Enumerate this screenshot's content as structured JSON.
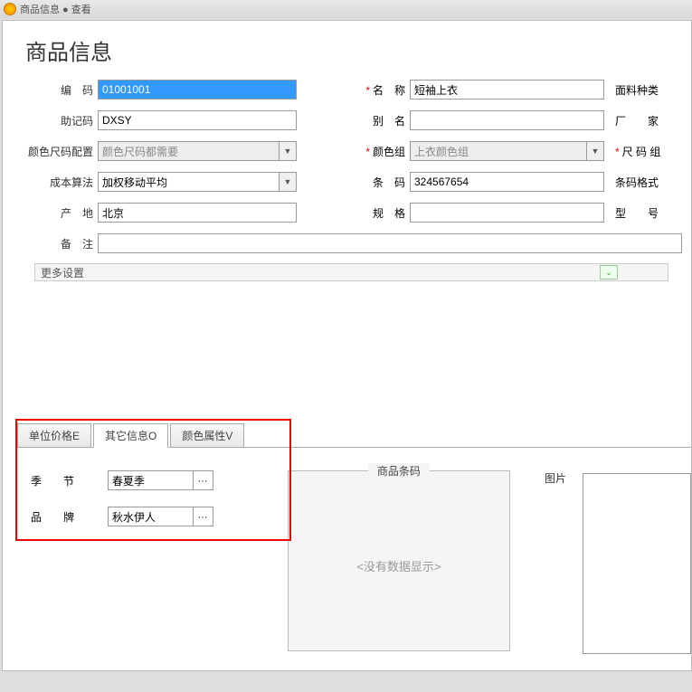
{
  "titlebar": {
    "text": "商品信息 ● 查看"
  },
  "page_title": "商品信息",
  "fields": {
    "code": {
      "label": "编　码",
      "value": "01001001"
    },
    "mnemonic": {
      "label": "助记码",
      "value": "DXSY"
    },
    "colorsize": {
      "label": "颜色尺码配置",
      "value": "颜色尺码都需要"
    },
    "cost": {
      "label": "成本算法",
      "value": "加权移动平均"
    },
    "origin": {
      "label": "产　地",
      "value": "北京"
    },
    "remark": {
      "label": "备　注",
      "value": ""
    },
    "name": {
      "label": "名　称",
      "value": "短袖上衣"
    },
    "alias": {
      "label": "别　名",
      "value": ""
    },
    "colorgroup": {
      "label": "颜色组",
      "value": "上衣颜色组"
    },
    "barcode": {
      "label": "条　码",
      "value": "324567654"
    },
    "spec": {
      "label": "规　格",
      "value": ""
    },
    "material": {
      "label": "面料种类"
    },
    "factory": {
      "label": "厂　　家"
    },
    "sizegroup": {
      "label": "尺 码 组"
    },
    "barcodefmt": {
      "label": "条码格式"
    },
    "model": {
      "label": "型　　号"
    }
  },
  "more_settings": "更多设置",
  "tabs": {
    "unit_price": "单位价格E",
    "other_info": "其它信息O",
    "color_attr": "颜色属性V"
  },
  "lower": {
    "season": {
      "label": "季　　节",
      "value": "春夏季"
    },
    "brand": {
      "label": "品　　牌",
      "value": "秋水伊人"
    },
    "barcode_panel": "商品条码",
    "nodata": "<没有数据显示>",
    "image": "图片"
  }
}
